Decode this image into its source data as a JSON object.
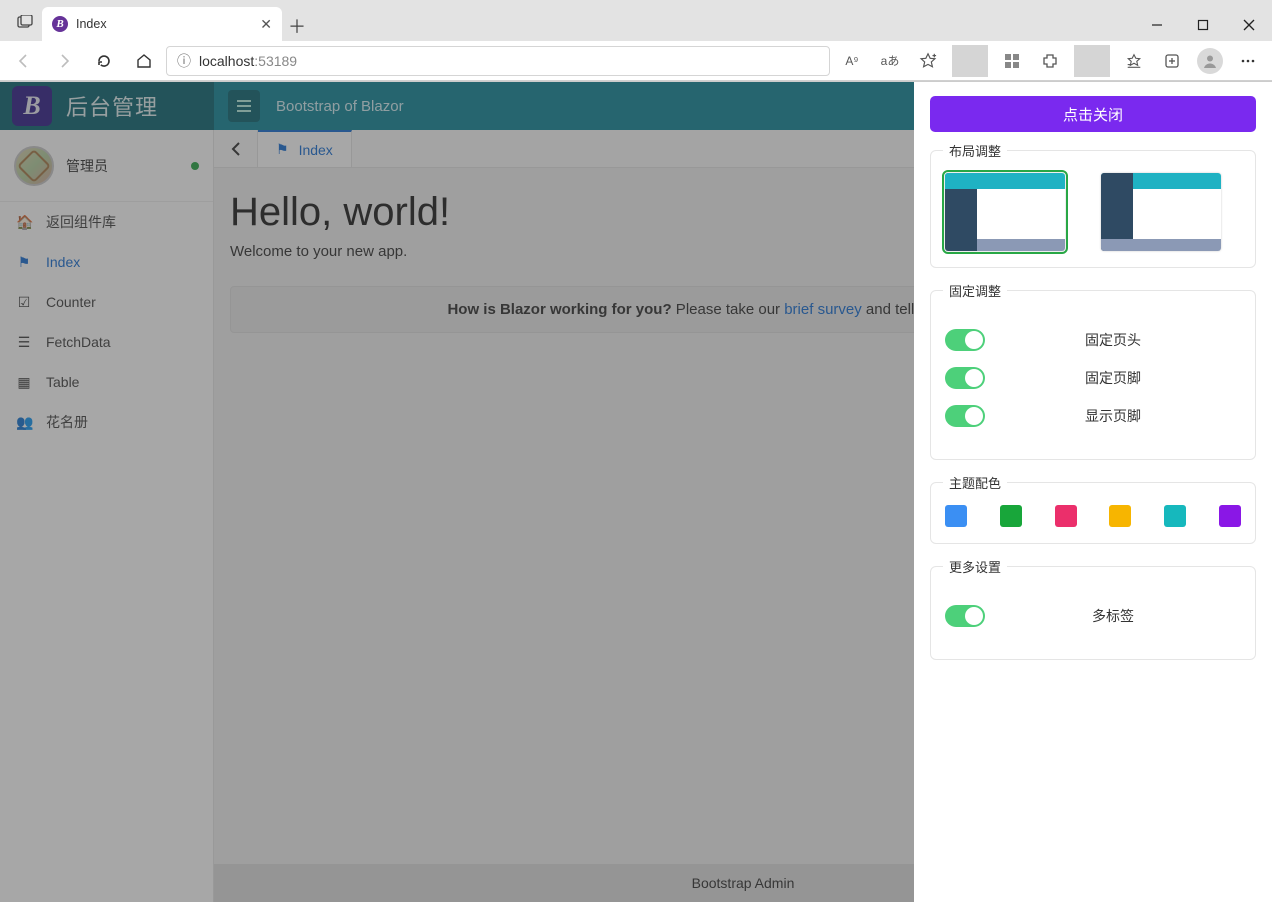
{
  "browser": {
    "tab_title": "Index",
    "url_host": "localhost",
    "url_port": ":53189",
    "read_aloud": "A⁹",
    "translate": "aあ"
  },
  "brand": {
    "badge": "B",
    "title": "后台管理"
  },
  "header": {
    "title": "Bootstrap of Blazor"
  },
  "user": {
    "name": "管理员"
  },
  "sidebar": {
    "items": [
      {
        "icon": "home-icon",
        "label": "返回组件库"
      },
      {
        "icon": "flag-icon",
        "label": "Index"
      },
      {
        "icon": "check-icon",
        "label": "Counter"
      },
      {
        "icon": "database-icon",
        "label": "FetchData"
      },
      {
        "icon": "table-icon",
        "label": "Table"
      },
      {
        "icon": "users-icon",
        "label": "花名册"
      }
    ]
  },
  "tabs": {
    "active": "Index"
  },
  "page": {
    "heading": "Hello, world!",
    "welcome": "Welcome to your new app.",
    "survey_bold": "How is Blazor working for you?",
    "survey_before": " Please take our ",
    "survey_link": "brief survey",
    "survey_after": " and tell us what you think."
  },
  "footer": "Bootstrap Admin",
  "drawer": {
    "close": "点击关闭",
    "section_layout": "布局调整",
    "section_fixed": "固定调整",
    "fixed_header": "固定页头",
    "fixed_footer": "固定页脚",
    "show_footer": "显示页脚",
    "section_theme": "主题配色",
    "theme_colors": [
      "#3b8ff3",
      "#18a63a",
      "#eb2f6b",
      "#f7b500",
      "#16b8bd",
      "#8a17e6"
    ],
    "section_more": "更多设置",
    "multi_tab": "多标签"
  }
}
